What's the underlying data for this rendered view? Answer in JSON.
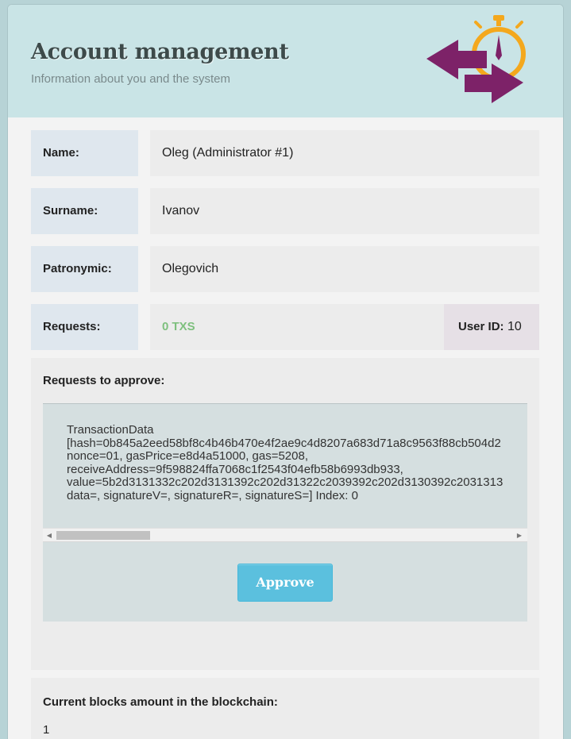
{
  "header": {
    "title": "Account management",
    "subtitle": "Information about you and the system",
    "logo_icon": "exchange-arrows-stopwatch-icon",
    "accent_purple": "#7d2268",
    "accent_orange": "#f4a81d"
  },
  "profile": {
    "name_label": "Name:",
    "name_value": "Oleg (Administrator #1)",
    "surname_label": "Surname:",
    "surname_value": "Ivanov",
    "patronymic_label": "Patronymic:",
    "patronymic_value": "Olegovich",
    "requests_label": "Requests:",
    "requests_value": "0 TXS",
    "user_id_label": "User ID:",
    "user_id_value": "10"
  },
  "approvals": {
    "title": "Requests to approve:",
    "transaction_text": "TransactionData\n[hash=0b845a2eed58bf8c4b46b470e4f2ae9c4d8207a683d71a8c9563f88cb504d2\nnonce=01, gasPrice=e8d4a51000, gas=5208,\nreceiveAddress=9f598824ffa7068c1f2543f04efb58b6993db933,\nvalue=5b2d3131332c202d3131392c202d31322c2039392c202d3130392c2031313\ndata=, signatureV=, signatureR=, signatureS=] Index: 0",
    "approve_label": "Approve",
    "approve_color": "#5bc0de"
  },
  "blockchain": {
    "title": "Current blocks amount in the blockchain:",
    "value": "1"
  }
}
